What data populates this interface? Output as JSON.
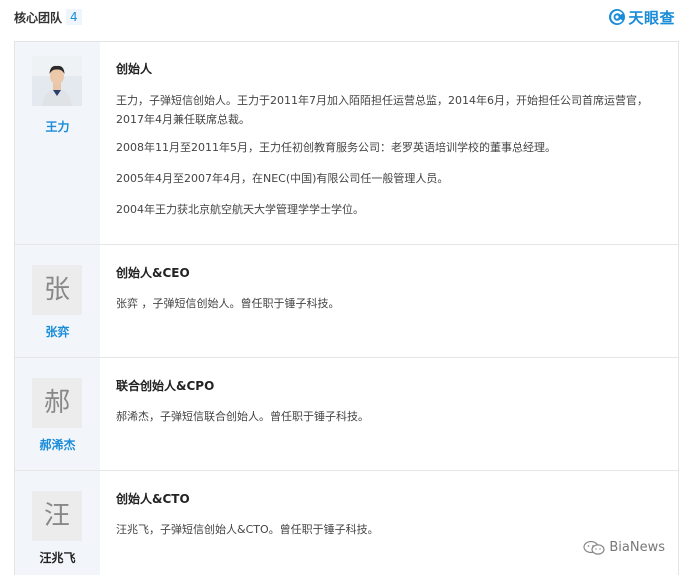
{
  "header": {
    "title": "核心团队",
    "count": "4"
  },
  "brand": {
    "name": "天眼查",
    "icon": "tianyancha-logo-icon",
    "color": "#1a8cd8"
  },
  "members": [
    {
      "name": "王力",
      "avatar": "photo",
      "role": "创始人",
      "paragraphs": [
        "王力，子弹短信创始人。王力于2011年7月加入陌陌担任运营总监，2014年6月，开始担任公司首席运营官，2017年4月兼任联席总裁。",
        "2008年11月至2011年5月，王力任初创教育服务公司：老罗英语培训学校的董事总经理。",
        "2005年4月至2007年4月，在NEC(中国)有限公司任一般管理人员。",
        "2004年王力获北京航空航天大学管理学学士学位。"
      ]
    },
    {
      "name": "张弈",
      "avatar_char": "张",
      "role": "创始人&CEO",
      "paragraphs": [
        "张弈 ，子弹短信创始人。曾任职于锤子科技。"
      ]
    },
    {
      "name": "郝浠杰",
      "avatar_char": "郝",
      "role": "联合创始人&CPO",
      "paragraphs": [
        "郝浠杰，子弹短信联合创始人。曾任职于锤子科技。"
      ]
    },
    {
      "name": "汪兆飞",
      "avatar_char": "汪",
      "role": "创始人&CTO",
      "paragraphs": [
        "汪兆飞，子弹短信创始人&CTO。曾任职于锤子科技。"
      ]
    }
  ],
  "watermark": {
    "text": "BiaNews",
    "icon": "wechat-icon"
  },
  "colors": {
    "accent": "#1a8cd8",
    "left_panel": "#f2f6fa",
    "border": "#e4e4e4"
  }
}
